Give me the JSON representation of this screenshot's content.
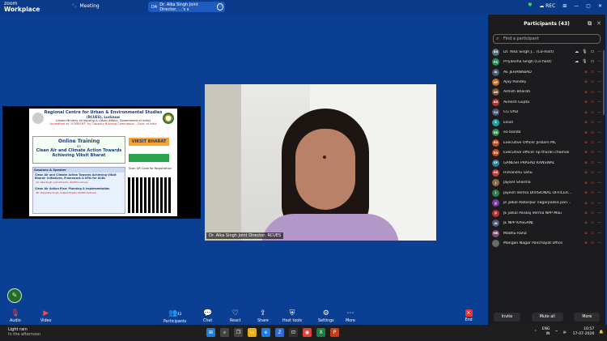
{
  "app": {
    "brand_top": "zoom",
    "brand_bottom": "Workplace"
  },
  "tabs": {
    "meeting": "Meeting",
    "share_initials": "DA",
    "share_label": "Dr. Alka Singh Joint Director, ...'s s"
  },
  "topright": {
    "rec": "REC"
  },
  "slide": {
    "org": "Regional Centre for Urban & Environmental Studies",
    "org_abbr": "(RCUES), Lucknow",
    "ministry": "(Under Ministry of Housing & Urban Affairs, Government of India)",
    "accreditation": "Accredited as \"UTKRISHT\" by Capacity Building Commission , Govt. of India",
    "training1": "Online Training",
    "training2": "on",
    "training3": "Clean Air and Climate Action Towards",
    "training4": "Achieving Viksit Bharat",
    "viksit": "VIKSIT BHARAT",
    "sessions_header": "Sessions & Speaker",
    "s1_title": "Clean Air and Climate Action Towards Achieving Viksit Bharat- Initiatives, Framework & KPIs for ULBs",
    "s1_speaker": "- Dr. Alka Singh, Joint Director, RCUES Lucknow",
    "s2_title": "Clean Air Action Plan: Planning & Implementation",
    "s2_speaker": "- Mr. Priyansha Singh, Subject Expert, RCUES Lucknow",
    "qr_label": "Scan QR Code for Registration"
  },
  "camera": {
    "label": "Dr. Alka Singh Joint Director, RCUES"
  },
  "participants": {
    "title": "Participants (43)",
    "search_placeholder": "Find a participant",
    "list": [
      {
        "initials": "DA",
        "name": "Dr. Alka Singh J... (Co-host)",
        "color": "#5b6f86"
      },
      {
        "initials": "PS",
        "name": "Priyansha Singh (Co-host)",
        "color": "#2f8f5b"
      },
      {
        "initials": "AJ",
        "name": "AE JEHANABAD",
        "color": "#4a5a78"
      },
      {
        "initials": "AP",
        "name": "Ajay Pandey",
        "color": "#c07020"
      },
      {
        "initials": "AB",
        "name": "Ashish Bharati",
        "color": "#7a5a3a"
      },
      {
        "initials": "AG",
        "name": "Avnesh Gupta",
        "color": "#b03a3a"
      },
      {
        "initials": "CU",
        "name": "CG UAD",
        "color": "#4a5a78"
      },
      {
        "initials": "E",
        "name": "Elson",
        "color": "#21a0a0"
      },
      {
        "initials": "EB",
        "name": "eo banda",
        "color": "#2f8f5b"
      },
      {
        "initials": "EO",
        "name": "Executive Officer Jiribam MC",
        "color": "#c05020"
      },
      {
        "initials": "EO",
        "name": "Executive officer np tharali chamoli",
        "color": "#c05020"
      },
      {
        "initials": "GP",
        "name": "GANESH PRASAD KANSWAL",
        "color": "#2f7fa0"
      },
      {
        "initials": "HS",
        "name": "Himanshu sahu",
        "color": "#c04040"
      },
      {
        "initials": "J",
        "name": "Jayant Sharma",
        "color": "#8a6a4a"
      },
      {
        "initials": "J",
        "name": "Jayesh Verma DIVISIONAL OFFICER...",
        "color": "#2f7f4a"
      },
      {
        "initials": "JJ",
        "name": "je jalkal Akbarpur nagarpalika pari...",
        "color": "#7a3a9a"
      },
      {
        "initials": "JJ",
        "name": "JE jalkal Pankaj Verma NPP Mau",
        "color": "#b03030"
      },
      {
        "initials": "JN",
        "name": "JE NPP KASGANJ",
        "color": "#4a5a78"
      },
      {
        "initials": "MR",
        "name": "Madhu Rana",
        "color": "#7a4a7a"
      },
      {
        "initials": "",
        "name": "Mangan Nagar Panchayat office",
        "color": "#6a6a6a"
      }
    ],
    "invite": "Invite",
    "mute_all": "Mute all",
    "more": "More"
  },
  "toolbar": {
    "audio": "Audio",
    "video": "Video",
    "participants": "Participants",
    "participants_count": "43",
    "chat": "Chat",
    "react": "React",
    "share": "Share",
    "host_tools": "Host tools",
    "settings": "Settings",
    "more": "More",
    "end": "End"
  },
  "taskbar": {
    "weather_title": "Light rain",
    "weather_sub": "In the afternoon",
    "lang1": "ENG",
    "lang2": "IN",
    "time": "10:57",
    "date": "17-07-2026"
  }
}
